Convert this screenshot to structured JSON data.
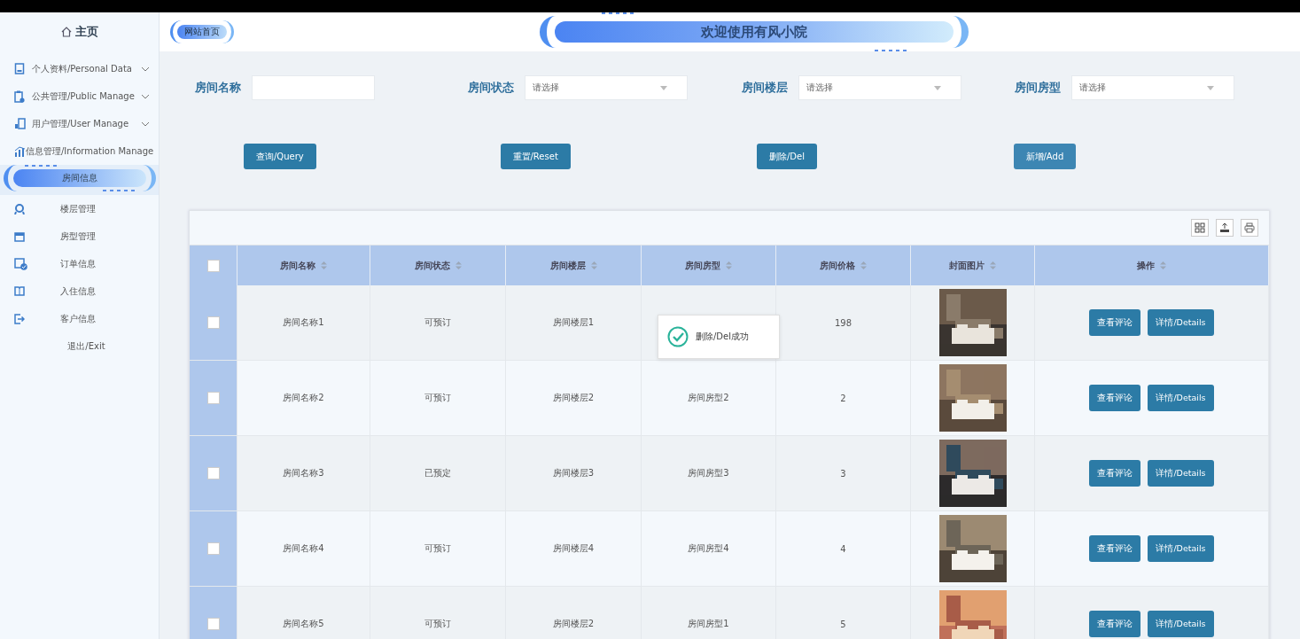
{
  "header": {
    "home_link": "网站首页",
    "title": "欢迎使用有风小院"
  },
  "sidebar": {
    "home": "主页",
    "items": [
      {
        "kind": "group",
        "label": "个人资料/Personal Data",
        "selected": false
      },
      {
        "kind": "group",
        "label": "公共管理/Public Manage",
        "selected": false
      },
      {
        "kind": "group",
        "label": "用户管理/User Manage",
        "selected": false
      },
      {
        "kind": "group",
        "label": "信息管理/Information Manage",
        "selected": false
      },
      {
        "kind": "item",
        "label": "房间信息",
        "selected": true
      },
      {
        "kind": "item",
        "label": "楼层管理",
        "selected": false
      },
      {
        "kind": "item",
        "label": "房型管理",
        "selected": false
      },
      {
        "kind": "item",
        "label": "订单信息",
        "selected": false
      },
      {
        "kind": "item",
        "label": "入住信息",
        "selected": false
      },
      {
        "kind": "item",
        "label": "客户信息",
        "selected": false
      },
      {
        "kind": "plain",
        "label": "退出/Exit",
        "selected": false
      }
    ]
  },
  "filters": [
    {
      "kind": "text",
      "label": "房间名称"
    },
    {
      "kind": "select",
      "label": "房间状态",
      "placeholder": "请选择"
    },
    {
      "kind": "select",
      "label": "房间楼层",
      "placeholder": "请选择"
    },
    {
      "kind": "select",
      "label": "房间房型",
      "placeholder": "请选择"
    }
  ],
  "buttons": [
    "查询/Query",
    "重置/Reset",
    "删除/Del",
    "新增/Add"
  ],
  "table": {
    "select_all_checked": false,
    "columns": [
      "房间名称",
      "房间状态",
      "房间楼层",
      "房间房型",
      "房间价格",
      "封面图片",
      "操作"
    ],
    "rows": [
      {
        "checked": false,
        "name": "房间名称1",
        "status": "可预订",
        "floor": "房间楼层1",
        "price": "198",
        "actions": [
          "查看评论",
          "详情/Details"
        ]
      },
      {
        "checked": false,
        "name": "房间名称2",
        "status": "可预订",
        "floor": "房间楼层2",
        "type": "房间房型2",
        "price": "2",
        "actions": [
          "查看评论",
          "详情/Details"
        ]
      },
      {
        "checked": false,
        "name": "房间名称3",
        "status": "已预定",
        "floor": "房间楼层3",
        "type": "房间房型3",
        "price": "3",
        "actions": [
          "查看评论",
          "详情/Details"
        ]
      },
      {
        "checked": false,
        "name": "房间名称4",
        "status": "可预订",
        "floor": "房间楼层4",
        "type": "房间房型4",
        "price": "4",
        "actions": [
          "查看评论",
          "详情/Details"
        ]
      },
      {
        "checked": false,
        "name": "房间名称5",
        "status": "可预订",
        "floor": "房间楼层2",
        "type": "房间房型1",
        "price": "5",
        "actions": [
          "查看评论",
          "详情/Details"
        ]
      }
    ]
  },
  "toast": {
    "message": "删除/Del成功"
  }
}
